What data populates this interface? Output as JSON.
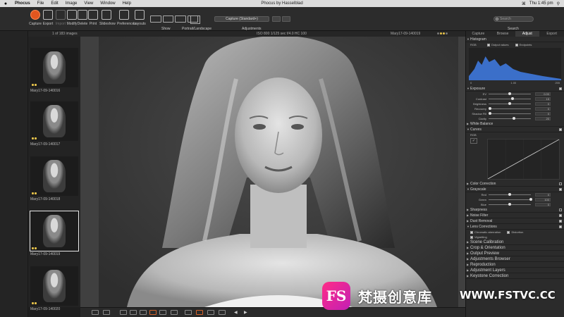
{
  "menubar": {
    "apple": "",
    "items": [
      "Phocus",
      "File",
      "Edit",
      "Image",
      "View",
      "Window",
      "Help"
    ],
    "window_title": "Phocus by Hasselblad",
    "clock": "Thu 1:45 pm"
  },
  "toolbar": {
    "buttons": [
      {
        "label": "Capture",
        "icon": "capture-icon"
      },
      {
        "label": "Export",
        "icon": "export-icon"
      },
      {
        "label": "Import",
        "icon": "import-icon"
      },
      {
        "label": "Modify",
        "icon": "modify-icon"
      },
      {
        "label": "Delete",
        "icon": "trash-icon"
      },
      {
        "label": "Print",
        "icon": "print-icon"
      },
      {
        "label": "Slideshow",
        "icon": "slideshow-icon"
      },
      {
        "label": "Preferences",
        "icon": "gear-icon"
      },
      {
        "label": "Layouts",
        "icon": "layout-icon"
      }
    ],
    "show_label": "Show",
    "portrait_label": "Portrait/Landscape",
    "adjust_select": "Capture (Standard+)",
    "adjustments_label": "Adjustments",
    "search_placeholder": "Search",
    "search_label": "Search"
  },
  "infostrip": {
    "count": "1 of 183 images",
    "meta": "ISO 800  1/125 sec  f/4.0  HC 100",
    "filename": "Mary17-09-140019"
  },
  "thumbnails": [
    {
      "name": "Mary17-09-140016",
      "selected": false
    },
    {
      "name": "Mary17-09-140017",
      "selected": false
    },
    {
      "name": "Mary17-09-140018",
      "selected": false
    },
    {
      "name": "Mary17-09-140019",
      "selected": true
    },
    {
      "name": "Mary17-09-140020",
      "selected": false
    }
  ],
  "rpanel": {
    "tabs": [
      "Capture",
      "Browse",
      "Adjust",
      "Export"
    ],
    "active_tab": "Adjust",
    "histogram": {
      "title": "Histogram",
      "mode": "RGB",
      "output_label": "Output values",
      "endpoints_label": "Endpoints",
      "scale_left": "0",
      "scale_mid": "1.00",
      "scale_right": "255"
    },
    "exposure": {
      "title": "Exposure",
      "sliders": [
        {
          "label": "EV",
          "value": "0.00",
          "pos": 0.5
        },
        {
          "label": "Contrast",
          "value": "15",
          "pos": 0.56
        },
        {
          "label": "Brightness",
          "value": "0",
          "pos": 0.5
        },
        {
          "label": "Recovery",
          "value": "0",
          "pos": 0.04
        },
        {
          "label": "Shadow Fill",
          "value": "0",
          "pos": 0.04
        },
        {
          "label": "Clarity",
          "value": "20",
          "pos": 0.6
        }
      ]
    },
    "white_balance": "White Balance",
    "curves": {
      "title": "Curves",
      "mode": "RGB"
    },
    "color_correction": "Color Correction",
    "grayscale": {
      "title": "Grayscale",
      "sliders": [
        {
          "label": "Red",
          "value": "0",
          "pos": 0.5
        },
        {
          "label": "Green",
          "value": "100",
          "pos": 1.0
        },
        {
          "label": "Blue",
          "value": "0",
          "pos": 0.5
        }
      ]
    },
    "sections_lower": [
      "Sharpness",
      "Noise Filter",
      "Dust Removal",
      "Lens Corrections"
    ],
    "lens_options": {
      "chromatic": "Chromatic aberration",
      "distortion": "Distortion",
      "vignetting": "Vignetting"
    },
    "sections_bottom": [
      "Scene Calibration",
      "Crop & Orientation",
      "Output Preview",
      "Adjustments Browser",
      "Reproduction",
      "Adjustment Layers",
      "Keystone Correction"
    ]
  },
  "watermark": {
    "logo": "FS",
    "text": "梵摄创意库",
    "url": "WWW.FSTVC.CC"
  },
  "colors": {
    "accent": "#e2561f",
    "brand": "#ff2d86",
    "panel_bg": "#2b2b2b"
  }
}
